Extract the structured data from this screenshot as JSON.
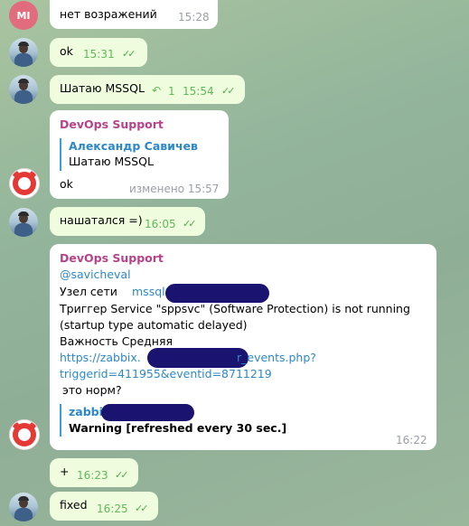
{
  "messages": [
    {
      "id": "m1",
      "text": "нет возражений",
      "time": "15:28",
      "avatar": "MI"
    },
    {
      "id": "m2",
      "text": "ok",
      "time": "15:31"
    },
    {
      "id": "m3",
      "text": "Шатаю MSSQL",
      "reply_count": "1",
      "time": "15:54"
    },
    {
      "id": "m4",
      "sender": "DevOps Support",
      "quote_name": "Александр Савичев",
      "quote_text": "Шатаю MSSQL",
      "text": "ok",
      "time": "изменено 15:57"
    },
    {
      "id": "m5",
      "text": "нашатался =)",
      "time": "16:05"
    },
    {
      "id": "m6",
      "sender": "DevOps Support",
      "mention": "@savicheval",
      "line1_label": "Узел сети",
      "line1_host": "mssql01",
      "line2": "Триггер  Service \"sppsvc\" (Software Protection) is not running",
      "line3": "(startup type automatic delayed)",
      "line4": "Важность  Средняя",
      "link1a": "https://zabbix.",
      "link1b": "r_events.php?",
      "link2": "triggerid=411955&eventid=8711219",
      "line5": "это норм?",
      "quote_name": "zabbix",
      "quote_text": "Warning [refreshed every 30 sec.]",
      "time": "16:22"
    },
    {
      "id": "m7",
      "text": "+",
      "time": "16:23"
    },
    {
      "id": "m8",
      "text": "fixed",
      "time": "16:25"
    }
  ],
  "icons": {
    "read": "double-check-icon",
    "reply": "reply-arrow-icon"
  },
  "colors": {
    "sender": "#b6428a",
    "link": "#2d88c7",
    "outgoing": "#effdde",
    "incoming": "#ffffff"
  }
}
